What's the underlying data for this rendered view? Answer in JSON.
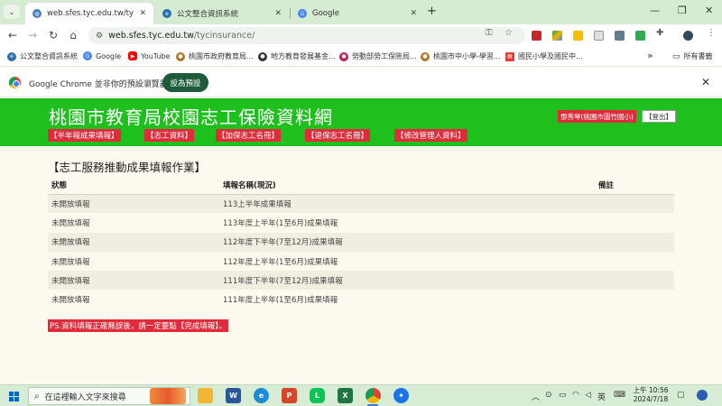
{
  "browser": {
    "tabs": [
      {
        "title": "web.sfes.tyc.edu.tw/tycinsura",
        "active": true,
        "icon": "globe-icon"
      },
      {
        "title": "公文整合資訊系統",
        "active": false,
        "icon": "edoc-icon"
      },
      {
        "title": "Google",
        "active": false,
        "icon": "google-icon"
      }
    ],
    "new_tab": "+",
    "url_host": "web.sfes.tyc.edu.tw",
    "url_path": "/tycinsurance/",
    "bookmarks": [
      {
        "label": "公文整合資訊系統",
        "icon": "edoc-icon",
        "color": "#2a6fb0"
      },
      {
        "label": "Google",
        "icon": "google-icon",
        "color": "#4285f4"
      },
      {
        "label": "YouTube",
        "icon": "youtube-icon",
        "color": "#ff0000"
      },
      {
        "label": "桃園市政府教育局...",
        "icon": "seal-icon",
        "color": "#b0772a"
      },
      {
        "label": "地方教育發展基金...",
        "icon": "fund-icon",
        "color": "#333333"
      },
      {
        "label": "勞動部勞工保險局...",
        "icon": "labor-icon",
        "color": "#c2185b"
      },
      {
        "label": "桃園市中小學-學習...",
        "icon": "school-icon",
        "color": "#b0772a"
      },
      {
        "label": "國民小學及國民中...",
        "icon": "doc-icon",
        "color": "#e53935"
      }
    ],
    "bookmarks_overflow": "»",
    "all_bookmarks": "所有書籤",
    "infobar_text": "Google Chrome 並非你的預設瀏覽器",
    "infobar_button": "設為預設"
  },
  "site": {
    "title": "桃園市教育局校園志工保險資料網",
    "user": "鄧秀琴(桃園市圖竹國小)",
    "logout": "【登出】",
    "menu": [
      "【半年報成果填報】",
      "【志工資料】",
      "【加保志工名冊】",
      "【退保志工名冊】",
      "【修改管理人資料】"
    ],
    "section_title": "【志工服務推動成果填報作業】",
    "table": {
      "headers": [
        "狀態",
        "填報名稱(現況)",
        "備註"
      ],
      "rows": [
        [
          "未開放填報",
          "113上半年成果填報",
          ""
        ],
        [
          "未開放填報",
          "113年度上半年(1至6月)成果填報",
          ""
        ],
        [
          "未開放填報",
          "112年度下半年(7至12月)成果填報",
          ""
        ],
        [
          "未開放填報",
          "112年度上半年(1至6月)成果填報",
          ""
        ],
        [
          "未開放填報",
          "111年度下半年(7至12月)成果填報",
          ""
        ],
        [
          "未開放填報",
          "111年度上半年(1至6月)成果填報",
          ""
        ]
      ]
    },
    "note": "PS.資料填報正確無誤後，請一定要點【完成填報】。",
    "colors": {
      "header_green": "#1ec01e",
      "red_label": "#e22b3a",
      "page_bg": "#fdf9ee"
    }
  },
  "taskbar": {
    "search_placeholder": "在這裡輸入文字來搜尋",
    "apps": [
      {
        "name": "file-explorer-icon",
        "color": "#f2b632",
        "glyph": ""
      },
      {
        "name": "word-icon",
        "color": "#2b579a",
        "glyph": "W"
      },
      {
        "name": "edge-icon",
        "color": "#1f8ad6",
        "glyph": "e"
      },
      {
        "name": "powerpoint-icon",
        "color": "#d24726",
        "glyph": "P"
      },
      {
        "name": "line-icon",
        "color": "#06c755",
        "glyph": "L"
      },
      {
        "name": "excel-icon",
        "color": "#217346",
        "glyph": "X"
      },
      {
        "name": "chrome-icon",
        "color": "#4285f4",
        "glyph": "●"
      },
      {
        "name": "app-icon",
        "color": "#1a73e8",
        "glyph": "✦"
      }
    ],
    "ime": "英",
    "time": "上午 10:56",
    "date": "2024/7/18"
  }
}
